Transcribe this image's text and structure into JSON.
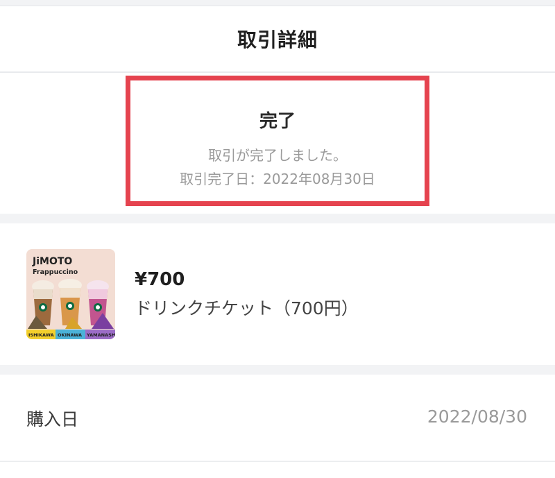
{
  "header": {
    "title": "取引詳細"
  },
  "status": {
    "title": "完了",
    "message": "取引が完了しました。",
    "date": "取引完了日：2022年08月30日"
  },
  "item": {
    "price": "¥700",
    "name": "ドリンクチケット（700円）",
    "thumbnail": {
      "brand_line1": "JiMOTO",
      "brand_line2": "Frappuccino",
      "labels": [
        "ISHIKAWA",
        "OKINAWA",
        "YAMANASHI"
      ]
    }
  },
  "details": {
    "purchase_date_label": "購入日",
    "purchase_date_value": "2022/08/30"
  },
  "colors": {
    "highlight_border": "#e5434f",
    "separator": "#f2f3f5",
    "muted_text": "#9a9a9a"
  }
}
